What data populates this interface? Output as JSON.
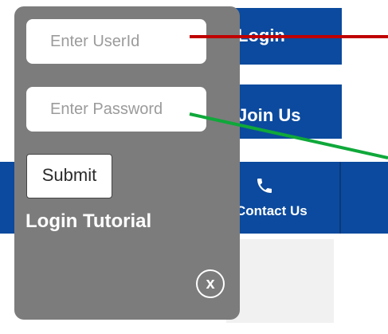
{
  "background": {
    "login_label": "Login",
    "join_label": "Join Us",
    "contact_label": "Contact Us",
    "contact_icon": "phone-icon"
  },
  "popup": {
    "userid_placeholder": "Enter UserId",
    "password_placeholder": "Enter Password",
    "submit_label": "Submit",
    "title": "Login Tutorial",
    "close_label": "x"
  },
  "colors": {
    "nav_blue": "#0b4a9e",
    "popup_gray": "#7c7c7c",
    "arrow_red": "#c00000",
    "arrow_green": "#0fa83a"
  }
}
